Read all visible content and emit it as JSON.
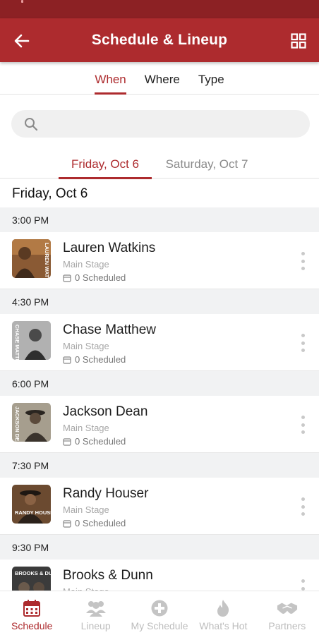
{
  "header": {
    "title": "Schedule & Lineup",
    "back_icon": "arrow-left-icon",
    "grid_icon": "grid-view-icon"
  },
  "colors": {
    "brand": "#ad2b2e",
    "status_bar": "#8c2124",
    "inactive": "#bdbdbd"
  },
  "filter_tabs": [
    {
      "label": "When",
      "active": true
    },
    {
      "label": "Where",
      "active": false
    },
    {
      "label": "Type",
      "active": false
    }
  ],
  "search": {
    "placeholder": "",
    "value": "",
    "icon": "search-icon"
  },
  "date_tabs": [
    {
      "label": "Friday, Oct 6",
      "active": true
    },
    {
      "label": "Saturday, Oct 7",
      "active": false
    }
  ],
  "day_heading": "Friday, Oct 6",
  "slots": [
    {
      "time": "3:00 PM",
      "artist": "Lauren Watkins",
      "stage": "Main Stage",
      "scheduled": "0 Scheduled"
    },
    {
      "time": "4:30 PM",
      "artist": "Chase Matthew",
      "stage": "Main Stage",
      "scheduled": "0 Scheduled"
    },
    {
      "time": "6:00 PM",
      "artist": "Jackson Dean",
      "stage": "Main Stage",
      "scheduled": "0 Scheduled"
    },
    {
      "time": "7:30 PM",
      "artist": "Randy Houser",
      "stage": "Main Stage",
      "scheduled": "0 Scheduled"
    },
    {
      "time": "9:30 PM",
      "artist": "Brooks & Dunn",
      "stage": "Main Stage",
      "scheduled": ""
    }
  ],
  "thumb_text": [
    "LAUREN WATKINS",
    "CHASE MATTHEW",
    "JACKSON DEAN",
    "RANDY HOUSER",
    "BROOKS & DUNN"
  ],
  "bottom_nav": [
    {
      "label": "Schedule",
      "icon": "calendar-icon",
      "active": true
    },
    {
      "label": "Lineup",
      "icon": "people-icon",
      "active": false
    },
    {
      "label": "My Schedule",
      "icon": "plus-circle-icon",
      "active": false
    },
    {
      "label": "What's Hot",
      "icon": "flame-icon",
      "active": false
    },
    {
      "label": "Partners",
      "icon": "handshake-icon",
      "active": false
    }
  ]
}
